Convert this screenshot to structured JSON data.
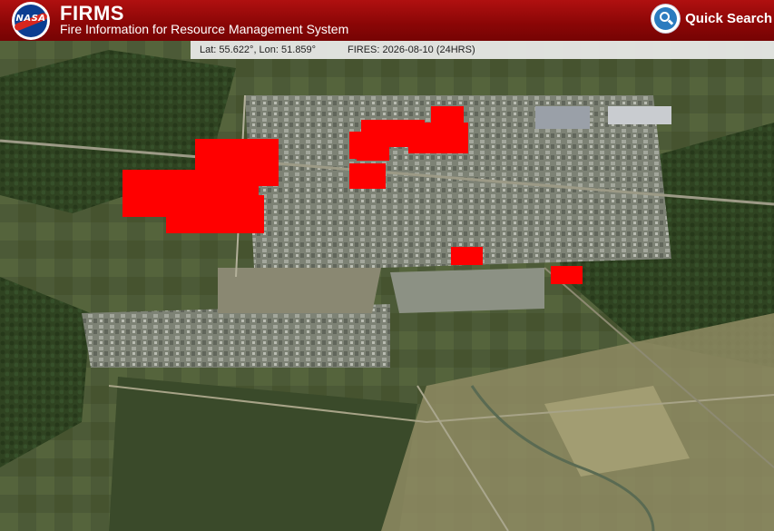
{
  "header": {
    "logo_text": "NASA",
    "title": "FIRMS",
    "subtitle": "Fire Information for Resource Management System",
    "quick_search_label": "Quick Search",
    "quick_search_icon": "search-icon"
  },
  "status_bar": {
    "coordinates": "Lat: 55.622°, Lon: 51.859°",
    "fires": "FIRES: 2026-08-10 (24HRS)"
  },
  "colors": {
    "header_red": "#8a0606",
    "fire": "#ff0000",
    "search_blue": "#2b7bbf"
  },
  "map": {
    "type": "satellite-imagery",
    "fire_detection_count": 12
  }
}
